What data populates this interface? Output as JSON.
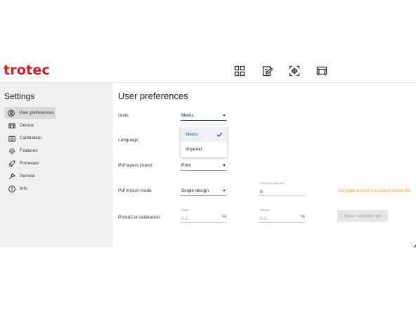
{
  "header": {
    "logo": "trotec",
    "icons": [
      "grid-icon",
      "edit-document-icon",
      "crosshair-frame-icon",
      "machine-icon"
    ]
  },
  "sidebar": {
    "title": "Settings",
    "items": [
      {
        "label": "User preferences",
        "icon": "user-circle-icon",
        "active": true
      },
      {
        "label": "Device",
        "icon": "device-icon",
        "active": false
      },
      {
        "label": "Calibration",
        "icon": "calibration-icon",
        "active": false
      },
      {
        "label": "Features",
        "icon": "gear-icon",
        "active": false
      },
      {
        "label": "Firmware",
        "icon": "rocket-icon",
        "active": false
      },
      {
        "label": "Service",
        "icon": "wrench-icon",
        "active": false
      },
      {
        "label": "Info",
        "icon": "info-icon",
        "active": false
      }
    ]
  },
  "main": {
    "title": "User preferences",
    "units": {
      "label": "Units",
      "value": "Metric"
    },
    "language": {
      "label": "Language"
    },
    "pdf_layers": {
      "label": "Pdf layers import",
      "value": "Print"
    },
    "pdf_mode": {
      "label": "Pdf import mode",
      "value": "Single design"
    },
    "page_limit": {
      "label": "Pdf import page limit",
      "value": "0"
    },
    "page_limit_hint": "Set page limit to 0 to import whole file",
    "printcut": {
      "label": "Print&Cut calibration"
    },
    "power": {
      "label": "Power",
      "value": "0.1",
      "unit": "%"
    },
    "velocity": {
      "label": "Velocity",
      "value": "0.1",
      "unit": "%"
    },
    "queue_button": "Queue calibration job"
  },
  "units_dropdown": {
    "options": [
      "Metric",
      "Imperial"
    ],
    "selected": "Metric"
  },
  "colors": {
    "brand": "#d2202a",
    "accent": "#2b4f8f",
    "hint": "#e8a033",
    "sidebar_bg": "#eef0f2"
  }
}
